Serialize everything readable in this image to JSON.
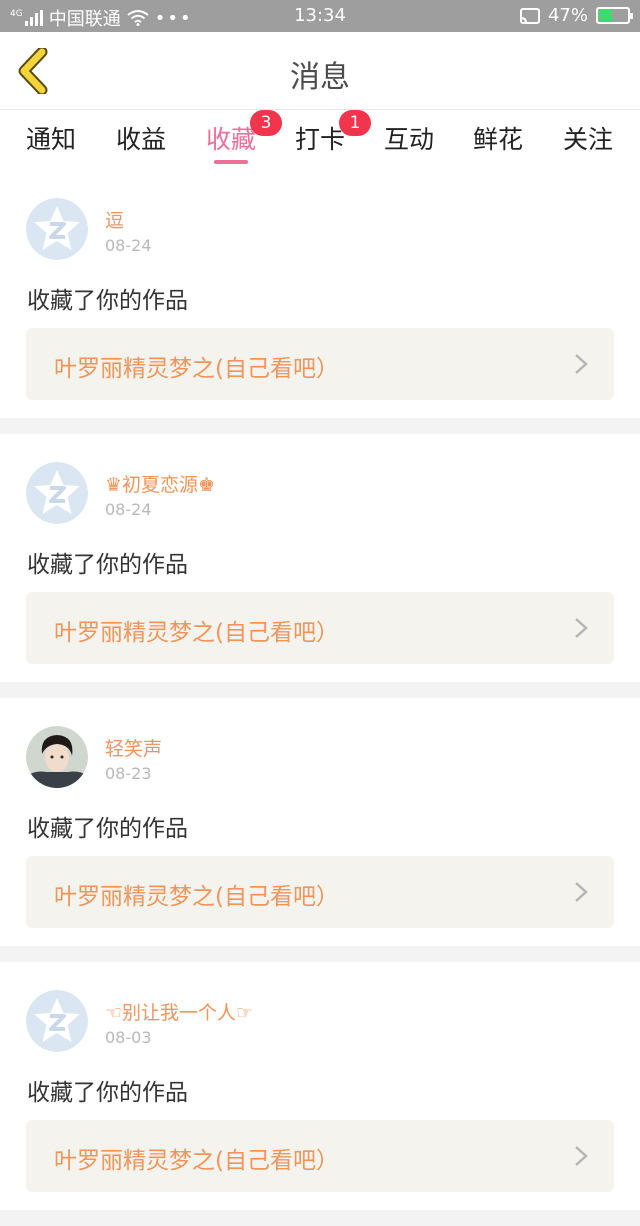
{
  "status": {
    "carrier": "中国联通",
    "network": "4G",
    "time": "13:34",
    "battery": "47%",
    "icons": [
      "signal-icon",
      "wifi-icon",
      "more-icon",
      "cast-icon",
      "battery-icon"
    ]
  },
  "header": {
    "title": "消息"
  },
  "tabs": [
    {
      "label": "通知"
    },
    {
      "label": "收益"
    },
    {
      "label": "收藏",
      "badge": "3"
    },
    {
      "label": "打卡",
      "badge": "1"
    },
    {
      "label": "互动"
    },
    {
      "label": "鲜花"
    },
    {
      "label": "关注"
    }
  ],
  "messages": [
    {
      "user": "逗",
      "date": "08-24",
      "text": "收藏了你的作品",
      "work": "叶罗丽精灵梦之(自己看吧）",
      "avatar": "default"
    },
    {
      "user": "♛初夏恋源♚",
      "date": "08-24",
      "text": "收藏了你的作品",
      "work": "叶罗丽精灵梦之(自己看吧）",
      "avatar": "default"
    },
    {
      "user": "轻笑声",
      "date": "08-23",
      "text": "收藏了你的作品",
      "work": "叶罗丽精灵梦之(自己看吧）",
      "avatar": "photo"
    },
    {
      "user": "☜别让我一个人☞",
      "date": "08-03",
      "text": "收藏了你的作品",
      "work": "叶罗丽精灵梦之(自己看吧）",
      "avatar": "default"
    }
  ],
  "colors": {
    "accent": "#ee6f97",
    "username": "#f0955b",
    "badge": "#f2344c",
    "back_arrow": "#f5d33a"
  }
}
